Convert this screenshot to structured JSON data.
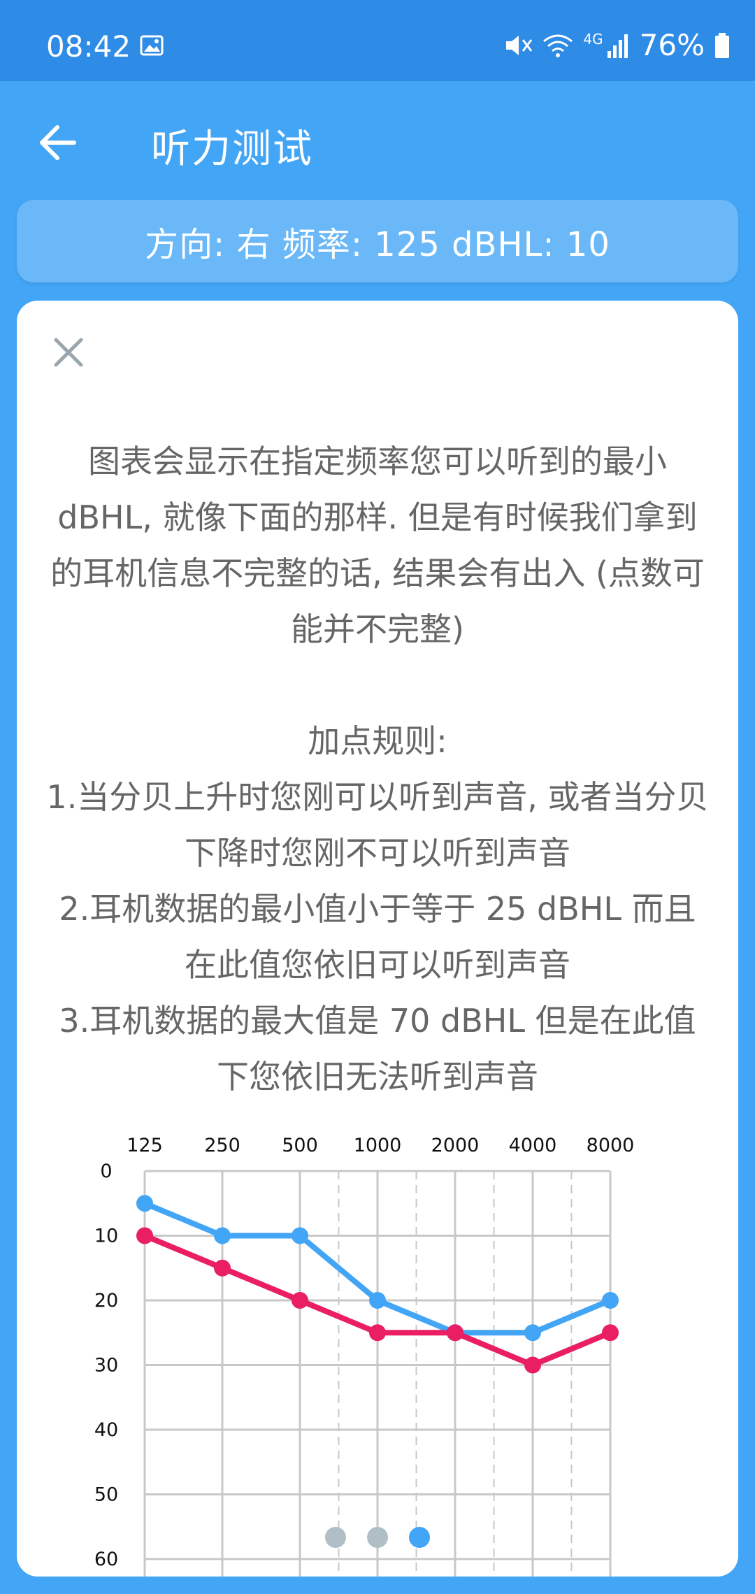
{
  "status": {
    "time": "08:42",
    "battery": "76%",
    "network": "4G",
    "icons": [
      "image-icon",
      "mute-icon",
      "wifi-icon",
      "signal-icon",
      "battery-icon"
    ]
  },
  "appbar": {
    "title": "听力测试",
    "back_icon": "arrow-left-icon"
  },
  "info": {
    "text": "方向: 右 频率: 125 dBHL: 10"
  },
  "dialog": {
    "close_icon": "close-icon",
    "intro": "图表会显示在指定频率您可以听到的最小 dBHL, 就像下面的那样. 但是有时候我们拿到的耳机信息不完整的话, 结果会有出入 (点数可能并不完整)",
    "rules_title": "加点规则:",
    "rules": [
      "1.当分贝上升时您刚可以听到声音, 或者当分贝下降时您刚不可以听到声音",
      "2.耳机数据的最小值小于等于 25 dBHL 而且在此值您依旧可以听到声音",
      "3.耳机数据的最大值是 70 dBHL 但是在此值下您依旧无法听到声音"
    ]
  },
  "colors": {
    "blue": "#42A5F5",
    "red": "#E91E63",
    "dot_inactive": "#B0BEC5",
    "dot_active": "#42A5F5"
  },
  "chart_data": {
    "type": "line",
    "categories": [
      "125",
      "250",
      "500",
      "1000",
      "2000",
      "4000",
      "8000"
    ],
    "y_ticks": [
      "0",
      "10",
      "20",
      "30",
      "40",
      "50",
      "60"
    ],
    "ylim": [
      0,
      60
    ],
    "y_inverted": true,
    "x_axis_position": "top",
    "grid": true,
    "series": [
      {
        "color": "#42A5F5",
        "values": [
          5,
          10,
          10,
          20,
          25,
          25,
          20
        ]
      },
      {
        "color": "#E91E63",
        "values": [
          10,
          15,
          20,
          25,
          25,
          30,
          25
        ]
      }
    ]
  },
  "pager": {
    "count": 3,
    "active": 2
  }
}
